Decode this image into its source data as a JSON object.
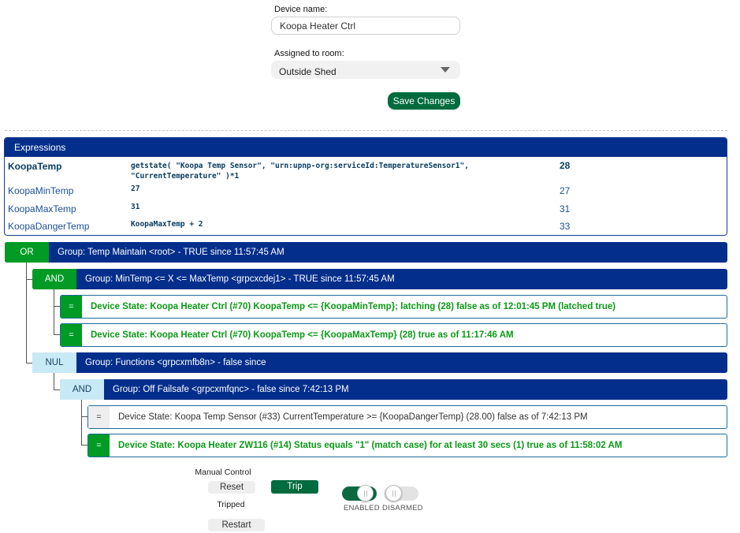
{
  "device_form": {
    "name_label": "Device name:",
    "name_value": "Koopa Heater Ctrl",
    "room_label": "Assigned to room:",
    "room_value": "Outside Shed",
    "save_label": "Save Changes"
  },
  "expressions": {
    "header": "Expressions",
    "rows": [
      {
        "name": "KoopaTemp",
        "expr_line1": "getstate( \"Koopa Temp Sensor\", \"urn:upnp-org:serviceId:TemperatureSensor1\",",
        "expr_line2": "\"CurrentTemperature\" )*1",
        "value": "28"
      },
      {
        "name": "KoopaMinTemp",
        "expr_line1": "27",
        "value": "27"
      },
      {
        "name": "KoopaMaxTemp",
        "expr_line1": "31",
        "value": "31"
      },
      {
        "name": "KoopaDangerTemp",
        "expr_line1": "KoopaMaxTemp + 2",
        "value": "33"
      }
    ]
  },
  "tree": {
    "root": {
      "op": "OR",
      "text": "Group: Temp Maintain <root> - TRUE since 11:57:45 AM"
    },
    "and1": {
      "op": "AND",
      "text": "Group: MinTemp <= X <= MaxTemp <grpcxcdej1> - TRUE since 11:57:45 AM"
    },
    "cond1": {
      "op": "=",
      "text": "Device State: Koopa Heater Ctrl (#70) KoopaTemp <= {KoopaMinTemp}; latching   (28) false as of 12:01:45 PM (latched true)"
    },
    "cond2": {
      "op": "=",
      "text": "Device State: Koopa Heater Ctrl (#70) KoopaTemp <= {KoopaMaxTemp}    (28) true as of 11:17:46 AM"
    },
    "nul": {
      "op": "NUL",
      "text": "Group: Functions <grpcxmfb8n> - false since"
    },
    "and2": {
      "op": "AND",
      "text": "Group: Off Failsafe <grpcxmfqnc> - false since 7:42:13 PM"
    },
    "cond3": {
      "op": "=",
      "text": "Device State: Koopa Temp Sensor (#33) CurrentTemperature >= {KoopaDangerTemp}    (28.00) false as of 7:42:13 PM"
    },
    "cond4": {
      "op": "=",
      "text": "Device State: Koopa Heater ZW116 (#14) Status equals \"1\" (match case) for at least 30 secs    (1) true as of 11:58:02 AM"
    }
  },
  "controls": {
    "manual_label": "Manual Control",
    "reset_label": "Reset",
    "trip_label": "Trip",
    "tripped_label": "Tripped",
    "restart_label": "Restart",
    "enabled_label": "ENABLED",
    "disarmed_label": "DISARMED"
  },
  "colors": {
    "header_blue": "#042e8c",
    "op_green": "#009b25",
    "button_green": "#006b3f",
    "nul_light": "#c8eaf6",
    "true_text_green": "#0a9a16"
  },
  "icons": {
    "room_dropdown": "chevron-down-icon"
  }
}
